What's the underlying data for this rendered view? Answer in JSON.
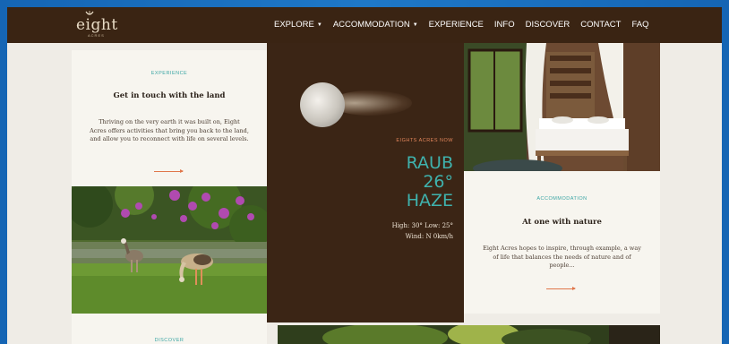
{
  "nav": {
    "logo": "eight",
    "logo_sub": "ACRES",
    "items": [
      {
        "label": "EXPLORE",
        "dropdown": true
      },
      {
        "label": "ACCOMMODATION",
        "dropdown": true
      },
      {
        "label": "EXPERIENCE",
        "dropdown": false
      },
      {
        "label": "INFO",
        "dropdown": false
      },
      {
        "label": "DISCOVER",
        "dropdown": false
      },
      {
        "label": "CONTACT",
        "dropdown": false
      },
      {
        "label": "FAQ",
        "dropdown": false
      }
    ]
  },
  "experience_card": {
    "eyebrow": "EXPERIENCE",
    "heading": "Get in touch with the land",
    "body": "Thriving on the very earth it was built on, Eight Acres offers activities that bring you back to the land, and allow you to reconnect with life on several levels."
  },
  "weather": {
    "eyebrow": "EIGHTS ACRES NOW",
    "location": "RAUB",
    "temperature": "26°",
    "condition": "HAZE",
    "high_low": "High: 30° Low: 25°",
    "wind": "Wind: N 0km/h"
  },
  "accommodation_card": {
    "eyebrow": "ACCOMMODATION",
    "heading": "At one with nature",
    "body": "Eight Acres hopes to inspire, through example, a way of life that balances the needs of nature and of people..."
  },
  "discover_card": {
    "eyebrow": "DISCOVER"
  },
  "colors": {
    "nav_bg": "#3a2413",
    "accent_teal": "#3aa5a4",
    "accent_orange": "#e0764a"
  }
}
